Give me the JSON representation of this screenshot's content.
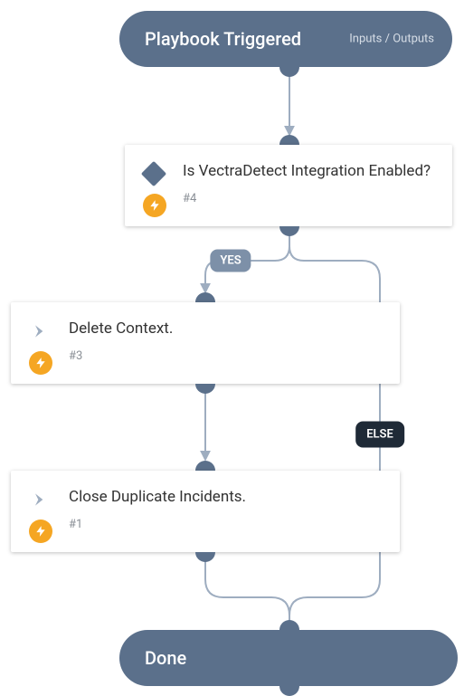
{
  "start": {
    "title": "Playbook Triggered",
    "io_link": "Inputs / Outputs"
  },
  "decision": {
    "title": "Is VectraDetect Integration Enabled?",
    "task_num": "#4"
  },
  "step1": {
    "title": "Delete Context.",
    "task_num": "#3"
  },
  "step2": {
    "title": "Close Duplicate Incidents.",
    "task_num": "#1"
  },
  "end": {
    "title": "Done"
  },
  "branch": {
    "yes": "YES",
    "else": "ELSE"
  }
}
